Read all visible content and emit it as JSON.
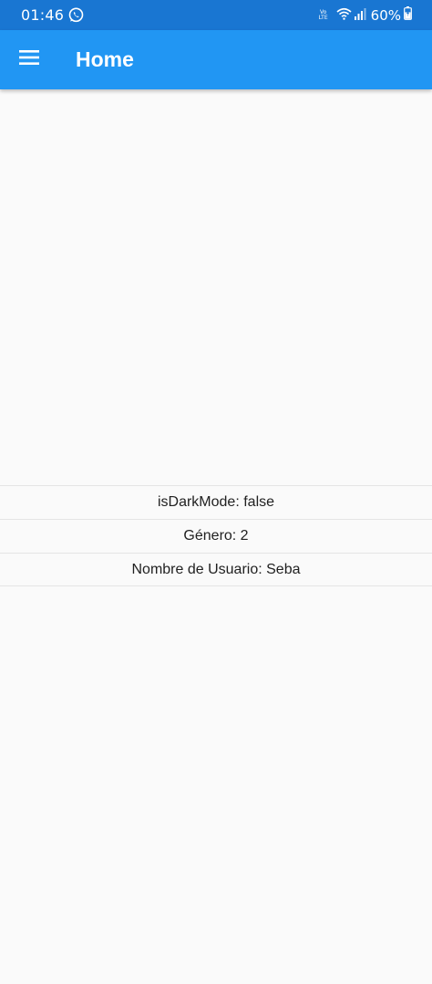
{
  "status_bar": {
    "time": "01:46",
    "battery": "60%",
    "volte_top": "Vo",
    "volte_bottom": "LTE",
    "icons": [
      "whatsapp-icon",
      "volte-icon",
      "wifi-icon",
      "signal-icon",
      "battery-icon"
    ]
  },
  "app_bar": {
    "title": "Home",
    "menu_icon": "menu-icon",
    "color": "#2196f3",
    "status_color": "#1976d2"
  },
  "list": {
    "items": [
      {
        "label": "isDarkMode: false"
      },
      {
        "label": "Género: 2"
      },
      {
        "label": "Nombre de Usuario: Seba"
      }
    ]
  }
}
